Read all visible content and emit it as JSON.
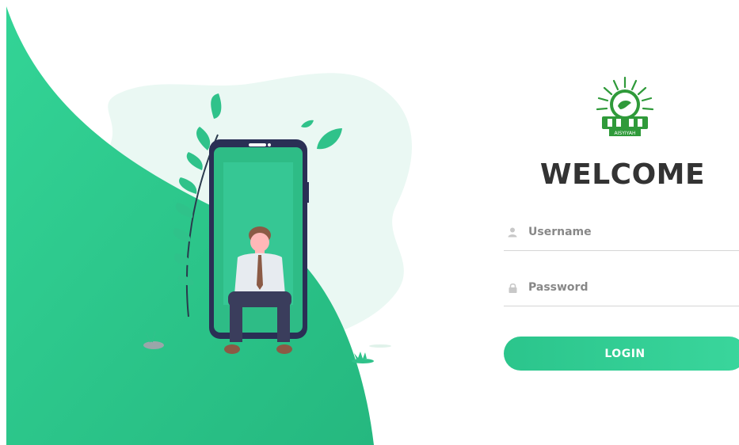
{
  "brand": {
    "logo_icon": "aisyiyah-logo-icon",
    "logo_text": "AISYIYAH",
    "accent": "#2bc58c"
  },
  "form": {
    "title": "WELCOME",
    "username": {
      "placeholder": "Username",
      "value": "",
      "icon": "user-icon"
    },
    "password": {
      "placeholder": "Password",
      "value": "",
      "icon": "lock-icon"
    },
    "login_label": "LOGIN"
  }
}
